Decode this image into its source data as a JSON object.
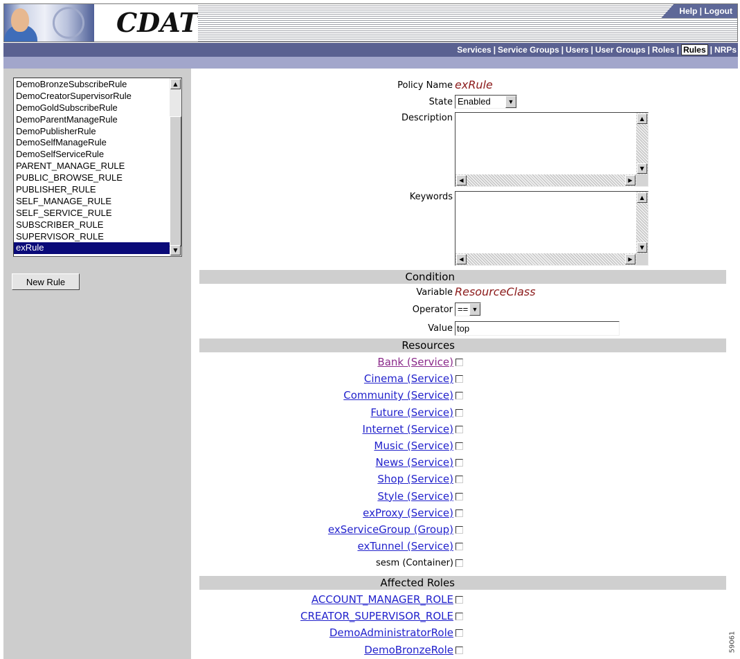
{
  "header": {
    "logo_text": "CDAT",
    "help_label": "Help",
    "separator": "|",
    "logout_label": "Logout"
  },
  "navbar": {
    "items": [
      {
        "label": "Services"
      },
      {
        "label": "Service Groups"
      },
      {
        "label": "Users"
      },
      {
        "label": "User Groups"
      },
      {
        "label": "Roles"
      },
      {
        "label": "Rules",
        "active": true
      },
      {
        "label": "NRPs"
      }
    ],
    "separator": "|"
  },
  "sidebar": {
    "rules": [
      "DemoBronzeSubscribeRule",
      "DemoCreatorSupervisorRule",
      "DemoGoldSubscribeRule",
      "DemoParentManageRule",
      "DemoPublisherRule",
      "DemoSelfManageRule",
      "DemoSelfServiceRule",
      "PARENT_MANAGE_RULE",
      "PUBLIC_BROWSE_RULE",
      "PUBLISHER_RULE",
      "SELF_MANAGE_RULE",
      "SELF_SERVICE_RULE",
      "SUBSCRIBER_RULE",
      "SUPERVISOR_RULE",
      "exRule"
    ],
    "selected_rule": "exRule",
    "new_rule_label": "New Rule"
  },
  "form": {
    "policy_name_label": "Policy Name",
    "policy_name_value": "exRule",
    "state_label": "State",
    "state_value": "Enabled",
    "description_label": "Description",
    "description_value": "",
    "keywords_label": "Keywords",
    "keywords_value": ""
  },
  "condition": {
    "section_title": "Condition",
    "variable_label": "Variable",
    "variable_value": "ResourceClass",
    "operator_label": "Operator",
    "operator_value": "==",
    "value_label": "Value",
    "value_value": "top"
  },
  "resources": {
    "section_title": "Resources",
    "items": [
      {
        "label": "Bank (Service)",
        "link": true,
        "visited": true,
        "checked": false
      },
      {
        "label": "Cinema (Service)",
        "link": true,
        "checked": false
      },
      {
        "label": "Community (Service)",
        "link": true,
        "checked": false
      },
      {
        "label": "Future (Service)",
        "link": true,
        "checked": false
      },
      {
        "label": "Internet (Service)",
        "link": true,
        "checked": false
      },
      {
        "label": "Music (Service)",
        "link": true,
        "checked": false
      },
      {
        "label": "News (Service)",
        "link": true,
        "checked": false
      },
      {
        "label": "Shop (Service)",
        "link": true,
        "checked": false
      },
      {
        "label": "Style (Service)",
        "link": true,
        "checked": false
      },
      {
        "label": "exProxy (Service)",
        "link": true,
        "checked": false
      },
      {
        "label": "exServiceGroup (Group)",
        "link": true,
        "checked": false
      },
      {
        "label": "exTunnel (Service)",
        "link": true,
        "checked": false
      },
      {
        "label": "sesm (Container)",
        "link": false,
        "checked": false
      }
    ]
  },
  "affected_roles": {
    "section_title": "Affected Roles",
    "items": [
      {
        "label": "ACCOUNT_MANAGER_ROLE",
        "checked": false
      },
      {
        "label": "CREATOR_SUPERVISOR_ROLE",
        "checked": false
      },
      {
        "label": "DemoAdministratorRole",
        "checked": false
      },
      {
        "label": "DemoBronzeRole",
        "checked": false
      }
    ]
  },
  "figure_id": "59061",
  "colors": {
    "nav_bar": "#5a6191",
    "sub_bar": "#a2a6cb",
    "left_panel": "#cdcdcd",
    "selected_item": "#0a0a78",
    "italic_value": "#8b1a1a",
    "link": "#2222cc",
    "visited_link": "#8a2a8a"
  }
}
